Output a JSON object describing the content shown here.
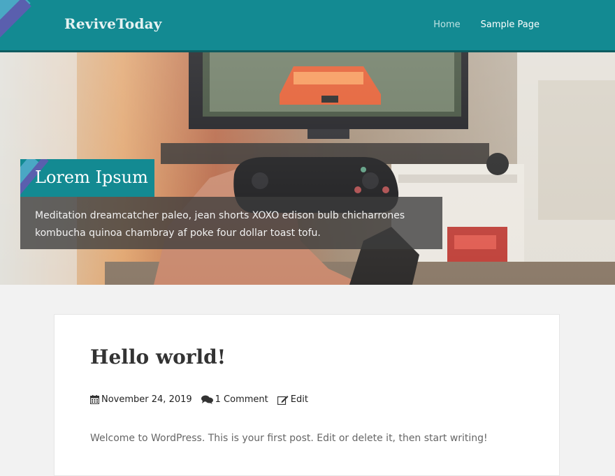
{
  "header": {
    "site_title": "ReviveToday",
    "nav": [
      {
        "label": "Home"
      },
      {
        "label": "Sample Page"
      }
    ]
  },
  "hero": {
    "title": "Lorem Ipsum",
    "caption": "Meditation dreamcatcher paleo, jean shorts XOXO edison bulb chicharrones kombucha quinoa chambray af poke four dollar toast tofu."
  },
  "post": {
    "title": "Hello world!",
    "date": "November 24, 2019",
    "comments": "1 Comment",
    "edit": "Edit",
    "excerpt": "Welcome to WordPress. This is your first post. Edit or delete it, then start writing!"
  },
  "icons": {
    "calendar": "calendar-icon",
    "comments": "comments-icon",
    "edit": "edit-icon"
  },
  "colors": {
    "header": "#138a92",
    "stripe_light": "#4aa8c4",
    "stripe_dark": "#5a5fae",
    "background": "#f2f2f2"
  }
}
